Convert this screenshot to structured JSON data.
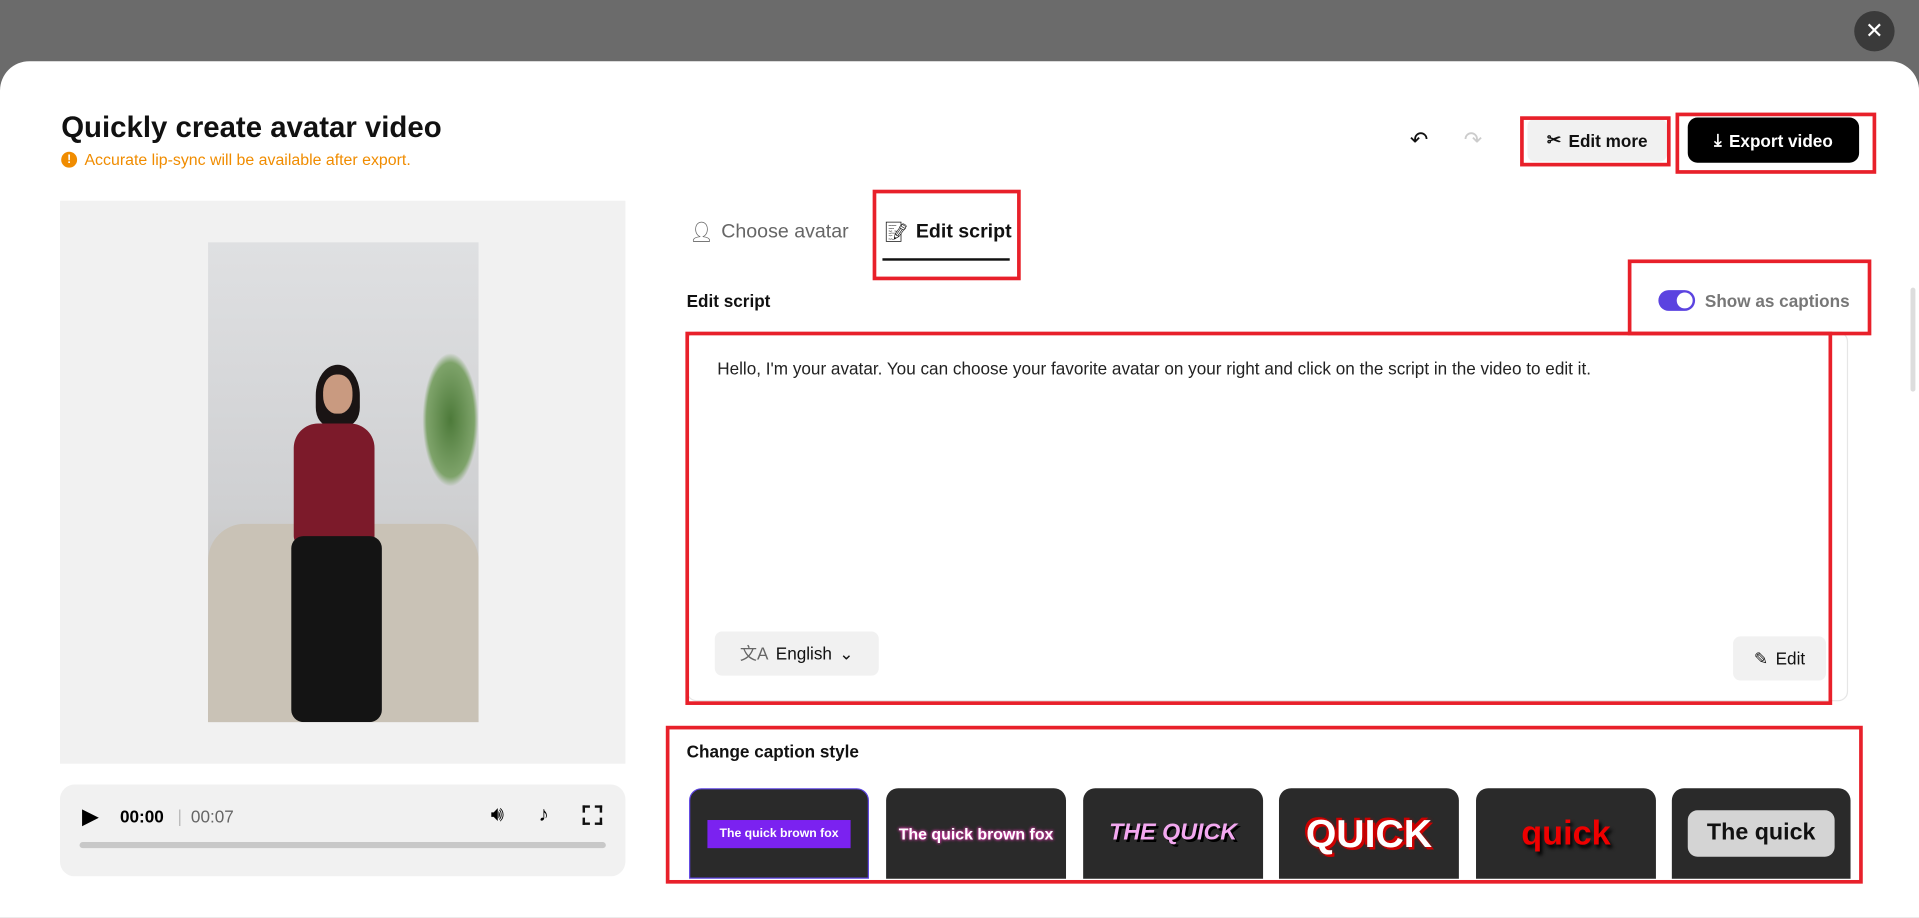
{
  "header": {
    "title": "Quickly create avatar video",
    "warning": "Accurate lip-sync will be available after export.",
    "edit_more": "Edit more",
    "export": "Export video"
  },
  "tabs": [
    {
      "label": "Choose avatar",
      "active": false
    },
    {
      "label": "Edit script",
      "active": true
    }
  ],
  "script": {
    "label": "Edit script",
    "show_captions_label": "Show as captions",
    "show_captions": true,
    "text": "Hello, I'm your avatar. You can choose your favorite avatar on your right and click on the script in the video to edit it.",
    "language": "English",
    "edit_label": "Edit"
  },
  "player": {
    "current": "00:00",
    "duration": "00:07",
    "progress": 0
  },
  "captions": {
    "label": "Change caption style",
    "styles": [
      "The quick brown fox",
      "The quick brown fox",
      "THE QUICK",
      "QUICK",
      "quick",
      "The quick"
    ],
    "selected": 0
  },
  "colors": {
    "accent": "#5b43e0",
    "warning": "#f08c00",
    "highlight": "#e8202a"
  }
}
